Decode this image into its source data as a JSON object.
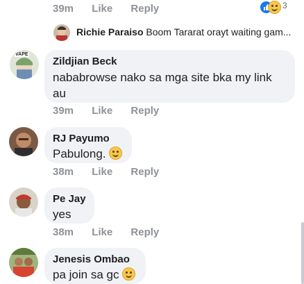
{
  "colors": {
    "bubble": "#f0f2f5",
    "meta": "#8e9197",
    "like_blue": "#1877f2",
    "haha_yellow": "#f7c74a"
  },
  "top_meta": {
    "time": "39m",
    "like": "Like",
    "reply": "Reply",
    "reaction_count": "3"
  },
  "reply_preview": {
    "name": "Richie Paraiso",
    "text": "Boom Tararat orayt waiting gam..."
  },
  "comments": [
    {
      "name": "Zildjian Beck",
      "line1": "nababrowse nako sa mga site bka my link",
      "line2": "au",
      "time": "39m",
      "like": "Like",
      "reply": "Reply",
      "avatar_badge": "VAPE"
    },
    {
      "name": "RJ Payumo",
      "text": "Pabulong.",
      "emoji": "winking-face-icon",
      "time": "38m",
      "like": "Like",
      "reply": "Reply"
    },
    {
      "name": "Pe Jay",
      "text": "yes",
      "time": "38m",
      "like": "Like",
      "reply": "Reply"
    },
    {
      "name": "Jenesis Ombao",
      "text": "pa join sa gc",
      "emoji": "grinning-face-icon"
    }
  ]
}
